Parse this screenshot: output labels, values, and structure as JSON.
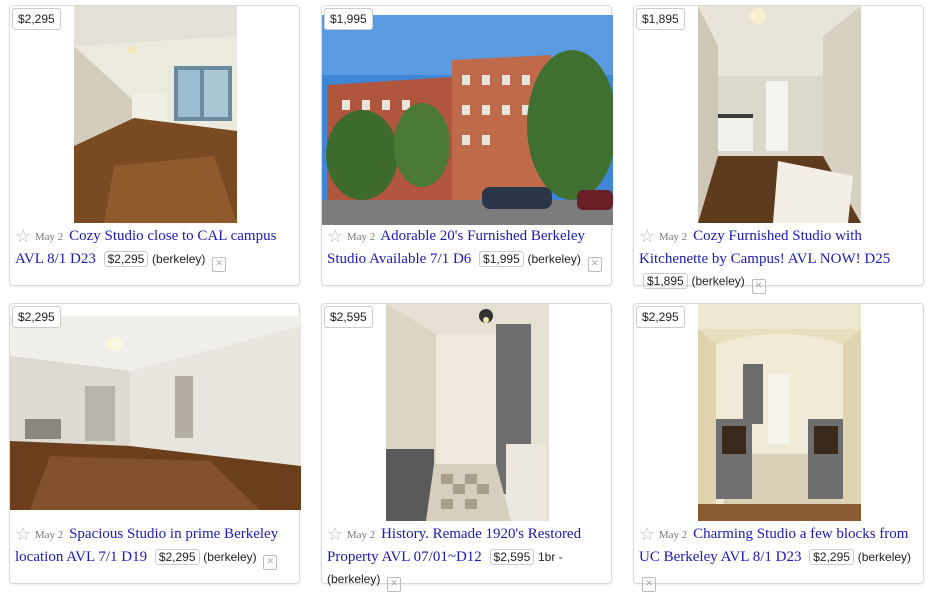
{
  "listings": [
    {
      "price": "$2,295",
      "date": "May 2",
      "title": "Cozy Studio close to CAL campus AVL 8/1 D23",
      "inline_price": "$2,295",
      "hood": "(berkeley)",
      "extra": ""
    },
    {
      "price": "$1,995",
      "date": "May 2",
      "title": "Adorable 20's Furnished Berkeley Studio Available 7/1 D6",
      "inline_price": "$1,995",
      "hood": "(berkeley)",
      "extra": ""
    },
    {
      "price": "$1,895",
      "date": "May 2",
      "title": "Cozy Furnished Studio with Kitchenette by Campus! AVL NOW! D25",
      "inline_price": "$1,895",
      "hood": "(berkeley)",
      "extra": ""
    },
    {
      "price": "$2,295",
      "date": "May 2",
      "title": "Spacious Studio in prime Berkeley location AVL 7/1 D19",
      "inline_price": "$2,295",
      "hood": "(berkeley)",
      "extra": ""
    },
    {
      "price": "$2,595",
      "date": "May 2",
      "title": "History. Remade 1920's Restored Property AVL 07/01~D12",
      "inline_price": "$2,595",
      "hood": "(berkeley)",
      "extra": "1br -"
    },
    {
      "price": "$2,295",
      "date": "May 2",
      "title": "Charming Studio a few blocks from UC Berkeley AVL 8/1 D23",
      "inline_price": "$2,295",
      "hood": "(berkeley)",
      "extra": ""
    }
  ],
  "icons": {
    "favorite": "star-icon",
    "hide": "hide-listing-icon"
  }
}
